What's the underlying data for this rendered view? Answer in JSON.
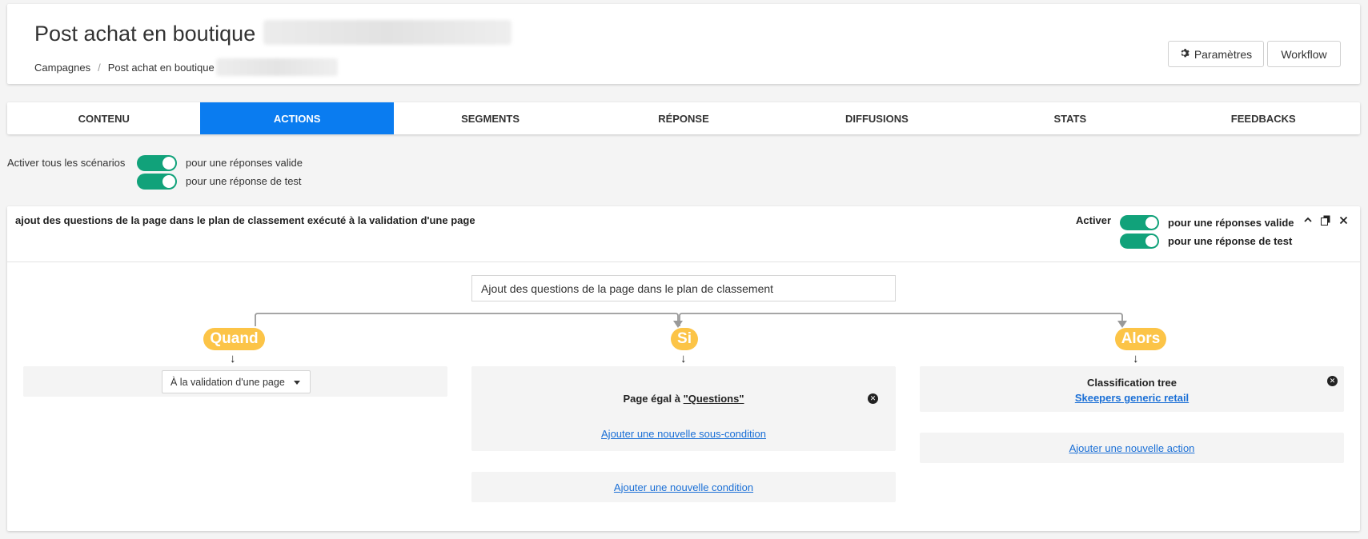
{
  "header": {
    "title": "Post achat en boutique",
    "breadcrumb": [
      "Campagnes",
      "Post achat en boutique"
    ],
    "breadcrumb_separator": "/",
    "buttons": {
      "settings": "Paramètres",
      "workflow": "Workflow"
    }
  },
  "tabs": [
    {
      "label": "CONTENU",
      "active": false
    },
    {
      "label": "ACTIONS",
      "active": true
    },
    {
      "label": "SEGMENTS",
      "active": false
    },
    {
      "label": "RÉPONSE",
      "active": false
    },
    {
      "label": "DIFFUSIONS",
      "active": false
    },
    {
      "label": "STATS",
      "active": false
    },
    {
      "label": "FEEDBACKS",
      "active": false
    }
  ],
  "global_toggles": {
    "label": "Activer tous les scénarios",
    "valid": "pour une réponses valide",
    "test": "pour une réponse de test"
  },
  "scenario": {
    "title": "ajout des questions de la page dans le plan de classement exécuté à la validation d'une page",
    "activate_label": "Activer",
    "valid": "pour une réponses valide",
    "test": "pour une réponse de test",
    "name_value": "Ajout des questions de la page dans le plan de classement",
    "when": {
      "label": "Quand",
      "trigger": "À la validation d'une page"
    },
    "if": {
      "label": "Si",
      "condition_prefix": "Page égal à",
      "condition_value": "\"Questions\"",
      "add_subcondition": "Ajouter une nouvelle sous-condition",
      "add_condition": "Ajouter une nouvelle condition"
    },
    "then": {
      "label": "Alors",
      "action_title": "Classification tree",
      "action_link": "Skeepers generic retail",
      "add_action": "Ajouter une nouvelle action"
    }
  },
  "colors": {
    "accent": "#0a7cf0",
    "toggle_on": "#11a27a",
    "pill": "#fcc447",
    "link": "#1a6fd6"
  }
}
